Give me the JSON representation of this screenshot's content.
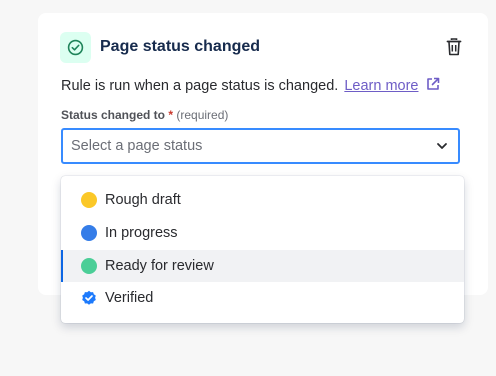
{
  "rule": {
    "title": "Page status changed",
    "description": "Rule is run when a page status is changed.",
    "learn_more": "Learn more"
  },
  "field": {
    "label": "Status changed to",
    "required_mark": "*",
    "required_text": "(required)",
    "placeholder": "Select a page status"
  },
  "menu": {
    "options": [
      {
        "label": "Rough draft",
        "color": "#fbc828",
        "icon": "yellow-dot"
      },
      {
        "label": "In progress",
        "color": "#357de8",
        "icon": "blue-dot"
      },
      {
        "label": "Ready for review",
        "color": "#4bce97",
        "icon": "green-dot",
        "hovered": true
      },
      {
        "label": "Verified",
        "color": "#1d7afc",
        "icon": "verified-badge-icon"
      }
    ]
  },
  "colors": {
    "accent": "#388bff",
    "link": "#6e5dc6",
    "status_icon_bg": "#dcfff1",
    "status_icon_fg": "#1f845a"
  }
}
